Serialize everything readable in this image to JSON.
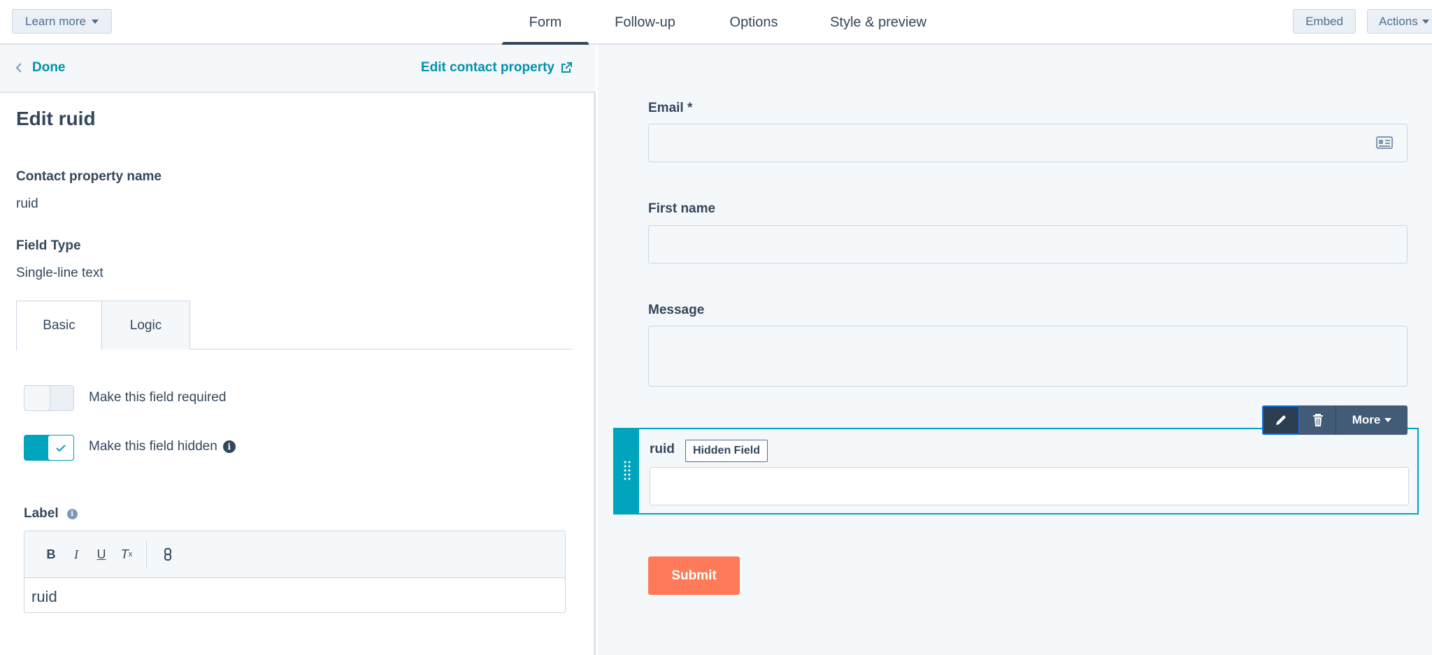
{
  "topnav": {
    "learn_more": "Learn more",
    "tabs": [
      {
        "label": "Form",
        "active": true
      },
      {
        "label": "Follow-up",
        "active": false
      },
      {
        "label": "Options",
        "active": false
      },
      {
        "label": "Style & preview",
        "active": false
      }
    ],
    "embed": "Embed",
    "actions": "Actions"
  },
  "panel": {
    "done": "Done",
    "edit_property": "Edit contact property",
    "title": "Edit ruid",
    "property_name_label": "Contact property name",
    "property_name_value": "ruid",
    "field_type_label": "Field Type",
    "field_type_value": "Single-line text",
    "tabs": {
      "basic": "Basic",
      "logic": "Logic"
    },
    "required_label": "Make this field required",
    "required_on": false,
    "hidden_label": "Make this field hidden",
    "hidden_on": true,
    "label_heading": "Label",
    "label_value": "ruid",
    "toolbar": {
      "bold": "B",
      "italic": "I",
      "underline": "U",
      "clear": "T"
    }
  },
  "preview": {
    "email_label": "Email *",
    "first_name_label": "First name",
    "message_label": "Message",
    "hidden_field_label": "ruid",
    "hidden_badge": "Hidden Field",
    "more": "More",
    "submit": "Submit"
  },
  "colors": {
    "accent": "#0091ae",
    "toggle_on": "#00a4bd",
    "submit": "#ff7a59",
    "text": "#33475b"
  }
}
